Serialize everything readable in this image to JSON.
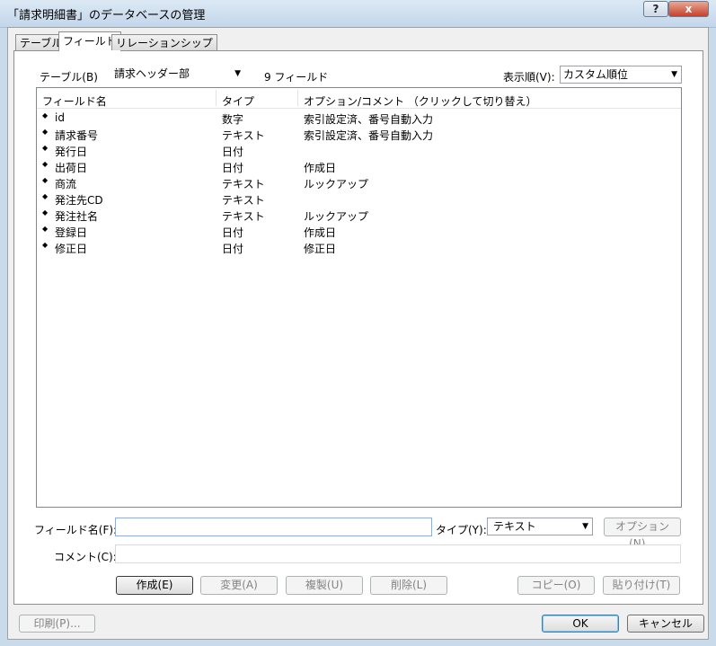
{
  "window": {
    "title": "「請求明細書」のデータベースの管理",
    "help_label": "?",
    "close_label": "x"
  },
  "tabs": [
    {
      "label": "テーブル",
      "active": false
    },
    {
      "label": "フィールド",
      "active": true
    },
    {
      "label": "リレーションシップ",
      "active": false
    }
  ],
  "table_selector": {
    "label": "テーブル(B):",
    "value": "請求ヘッダー部",
    "count_text": "9 フィールド"
  },
  "sort_selector": {
    "label": "表示順(V):",
    "value": "カスタム順位"
  },
  "field_list": {
    "columns": [
      "フィールド名",
      "タイプ",
      "オプション/コメント （クリックして切り替え）"
    ],
    "rows": [
      {
        "name": "id",
        "type": "数字",
        "options": "索引設定済、番号自動入力"
      },
      {
        "name": "請求番号",
        "type": "テキスト",
        "options": "索引設定済、番号自動入力"
      },
      {
        "name": "発行日",
        "type": "日付",
        "options": ""
      },
      {
        "name": "出荷日",
        "type": "日付",
        "options": "作成日"
      },
      {
        "name": "商流",
        "type": "テキスト",
        "options": "ルックアップ"
      },
      {
        "name": "発注先CD",
        "type": "テキスト",
        "options": ""
      },
      {
        "name": "発注社名",
        "type": "テキスト",
        "options": "ルックアップ"
      },
      {
        "name": "登録日",
        "type": "日付",
        "options": "作成日"
      },
      {
        "name": "修正日",
        "type": "日付",
        "options": "修正日"
      }
    ]
  },
  "field_editor": {
    "name_label": "フィールド名(F):",
    "name_value": "",
    "type_label": "タイプ(Y):",
    "type_value": "テキスト",
    "options_button": "オプション(N)...",
    "comment_label": "コメント(C):",
    "comment_value": ""
  },
  "action_buttons": {
    "create": "作成(E)",
    "change": "変更(A)",
    "duplicate": "複製(U)",
    "delete": "削除(L)",
    "copy": "コピー(O)",
    "paste": "貼り付け(T)"
  },
  "footer": {
    "print": "印刷(P)...",
    "ok": "OK",
    "cancel": "キャンセル"
  },
  "icons": {
    "row_bullet": "sort-handle-icon",
    "combo_arrow": "chevron-down-icon"
  }
}
